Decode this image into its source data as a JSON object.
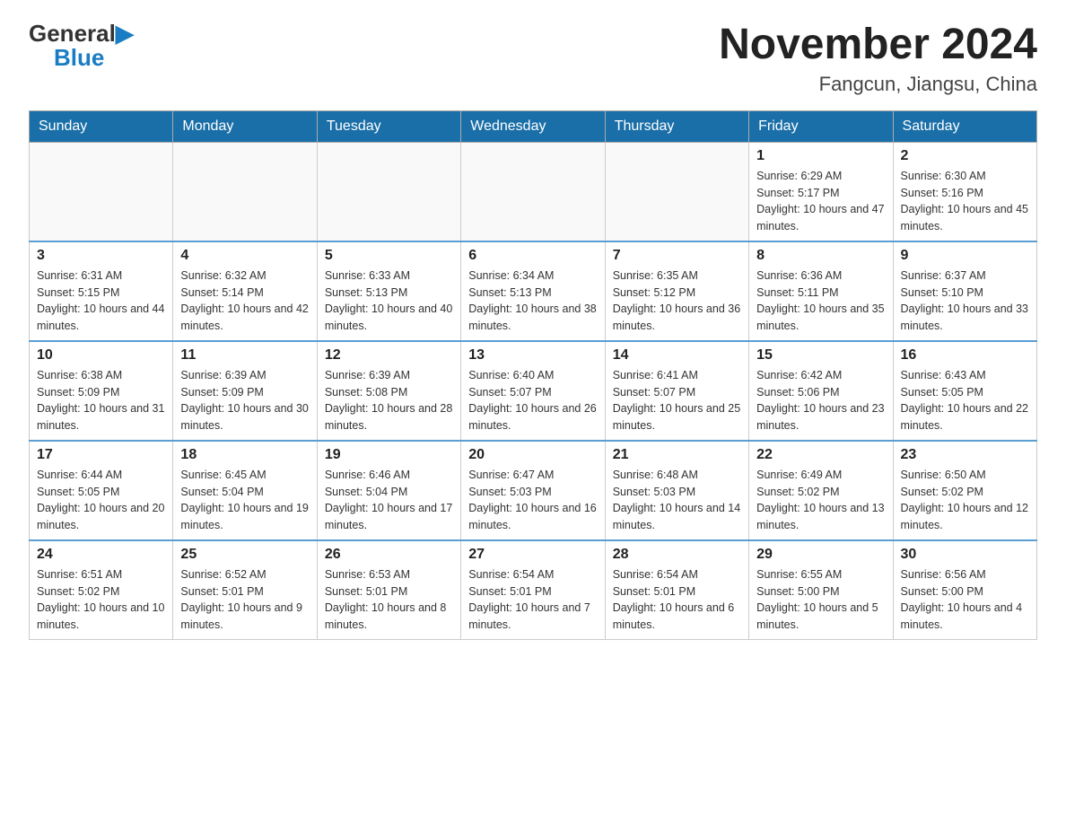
{
  "header": {
    "logo_general": "General",
    "logo_blue": "Blue",
    "title": "November 2024",
    "subtitle": "Fangcun, Jiangsu, China"
  },
  "days_of_week": [
    "Sunday",
    "Monday",
    "Tuesday",
    "Wednesday",
    "Thursday",
    "Friday",
    "Saturday"
  ],
  "weeks": [
    [
      {
        "day": "",
        "info": ""
      },
      {
        "day": "",
        "info": ""
      },
      {
        "day": "",
        "info": ""
      },
      {
        "day": "",
        "info": ""
      },
      {
        "day": "",
        "info": ""
      },
      {
        "day": "1",
        "info": "Sunrise: 6:29 AM\nSunset: 5:17 PM\nDaylight: 10 hours and 47 minutes."
      },
      {
        "day": "2",
        "info": "Sunrise: 6:30 AM\nSunset: 5:16 PM\nDaylight: 10 hours and 45 minutes."
      }
    ],
    [
      {
        "day": "3",
        "info": "Sunrise: 6:31 AM\nSunset: 5:15 PM\nDaylight: 10 hours and 44 minutes."
      },
      {
        "day": "4",
        "info": "Sunrise: 6:32 AM\nSunset: 5:14 PM\nDaylight: 10 hours and 42 minutes."
      },
      {
        "day": "5",
        "info": "Sunrise: 6:33 AM\nSunset: 5:13 PM\nDaylight: 10 hours and 40 minutes."
      },
      {
        "day": "6",
        "info": "Sunrise: 6:34 AM\nSunset: 5:13 PM\nDaylight: 10 hours and 38 minutes."
      },
      {
        "day": "7",
        "info": "Sunrise: 6:35 AM\nSunset: 5:12 PM\nDaylight: 10 hours and 36 minutes."
      },
      {
        "day": "8",
        "info": "Sunrise: 6:36 AM\nSunset: 5:11 PM\nDaylight: 10 hours and 35 minutes."
      },
      {
        "day": "9",
        "info": "Sunrise: 6:37 AM\nSunset: 5:10 PM\nDaylight: 10 hours and 33 minutes."
      }
    ],
    [
      {
        "day": "10",
        "info": "Sunrise: 6:38 AM\nSunset: 5:09 PM\nDaylight: 10 hours and 31 minutes."
      },
      {
        "day": "11",
        "info": "Sunrise: 6:39 AM\nSunset: 5:09 PM\nDaylight: 10 hours and 30 minutes."
      },
      {
        "day": "12",
        "info": "Sunrise: 6:39 AM\nSunset: 5:08 PM\nDaylight: 10 hours and 28 minutes."
      },
      {
        "day": "13",
        "info": "Sunrise: 6:40 AM\nSunset: 5:07 PM\nDaylight: 10 hours and 26 minutes."
      },
      {
        "day": "14",
        "info": "Sunrise: 6:41 AM\nSunset: 5:07 PM\nDaylight: 10 hours and 25 minutes."
      },
      {
        "day": "15",
        "info": "Sunrise: 6:42 AM\nSunset: 5:06 PM\nDaylight: 10 hours and 23 minutes."
      },
      {
        "day": "16",
        "info": "Sunrise: 6:43 AM\nSunset: 5:05 PM\nDaylight: 10 hours and 22 minutes."
      }
    ],
    [
      {
        "day": "17",
        "info": "Sunrise: 6:44 AM\nSunset: 5:05 PM\nDaylight: 10 hours and 20 minutes."
      },
      {
        "day": "18",
        "info": "Sunrise: 6:45 AM\nSunset: 5:04 PM\nDaylight: 10 hours and 19 minutes."
      },
      {
        "day": "19",
        "info": "Sunrise: 6:46 AM\nSunset: 5:04 PM\nDaylight: 10 hours and 17 minutes."
      },
      {
        "day": "20",
        "info": "Sunrise: 6:47 AM\nSunset: 5:03 PM\nDaylight: 10 hours and 16 minutes."
      },
      {
        "day": "21",
        "info": "Sunrise: 6:48 AM\nSunset: 5:03 PM\nDaylight: 10 hours and 14 minutes."
      },
      {
        "day": "22",
        "info": "Sunrise: 6:49 AM\nSunset: 5:02 PM\nDaylight: 10 hours and 13 minutes."
      },
      {
        "day": "23",
        "info": "Sunrise: 6:50 AM\nSunset: 5:02 PM\nDaylight: 10 hours and 12 minutes."
      }
    ],
    [
      {
        "day": "24",
        "info": "Sunrise: 6:51 AM\nSunset: 5:02 PM\nDaylight: 10 hours and 10 minutes."
      },
      {
        "day": "25",
        "info": "Sunrise: 6:52 AM\nSunset: 5:01 PM\nDaylight: 10 hours and 9 minutes."
      },
      {
        "day": "26",
        "info": "Sunrise: 6:53 AM\nSunset: 5:01 PM\nDaylight: 10 hours and 8 minutes."
      },
      {
        "day": "27",
        "info": "Sunrise: 6:54 AM\nSunset: 5:01 PM\nDaylight: 10 hours and 7 minutes."
      },
      {
        "day": "28",
        "info": "Sunrise: 6:54 AM\nSunset: 5:01 PM\nDaylight: 10 hours and 6 minutes."
      },
      {
        "day": "29",
        "info": "Sunrise: 6:55 AM\nSunset: 5:00 PM\nDaylight: 10 hours and 5 minutes."
      },
      {
        "day": "30",
        "info": "Sunrise: 6:56 AM\nSunset: 5:00 PM\nDaylight: 10 hours and 4 minutes."
      }
    ]
  ]
}
